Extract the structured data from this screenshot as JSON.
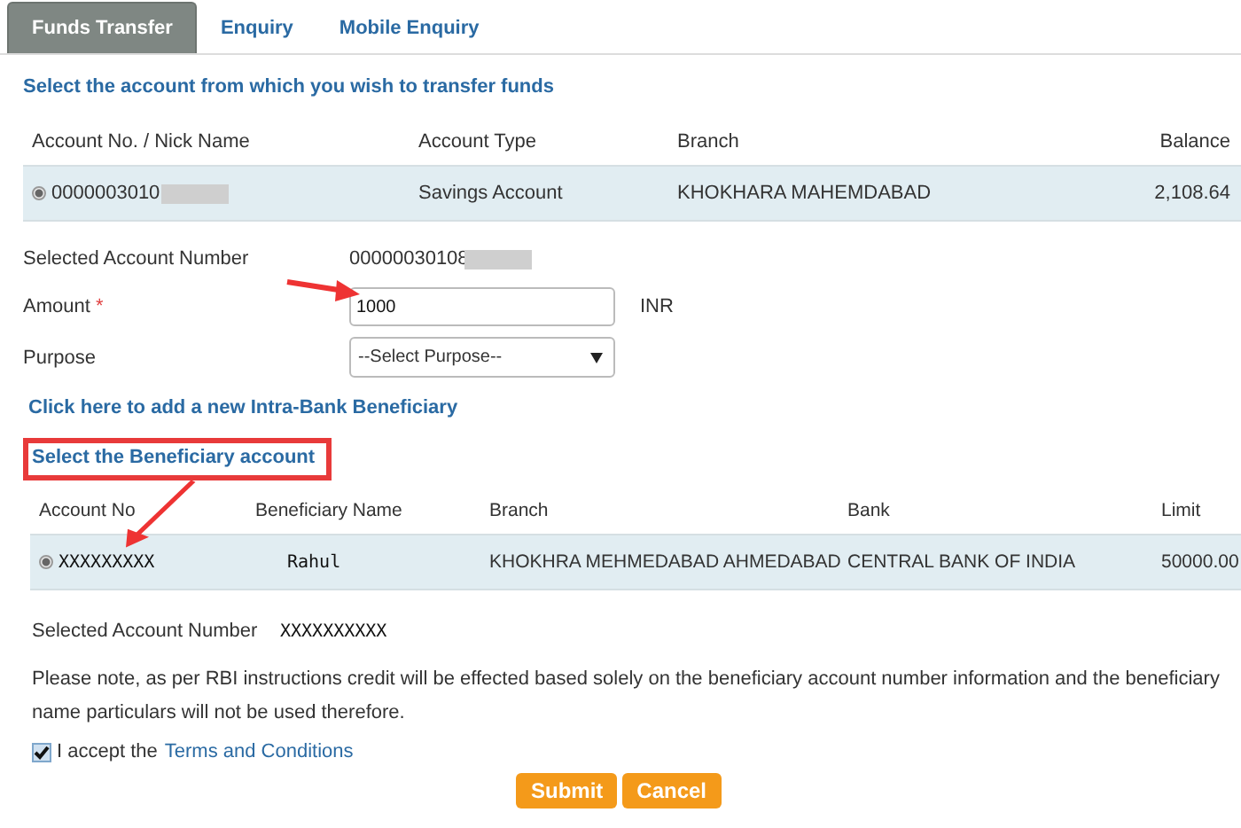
{
  "tabs": [
    {
      "label": "Funds Transfer",
      "selected": true
    },
    {
      "label": "Enquiry",
      "selected": false
    },
    {
      "label": "Mobile Enquiry",
      "selected": false
    }
  ],
  "source": {
    "heading": "Select the account from which you wish to transfer funds",
    "columns": [
      "Account No. / Nick Name",
      "Account Type",
      "Branch",
      "Balance"
    ],
    "rows": [
      {
        "account": "0000003010",
        "redacted": true,
        "type": "Savings Account",
        "branch": "KHOKHARA MAHEMDABAD",
        "balance": "2,108.64",
        "selected": true
      }
    ]
  },
  "selected_account": {
    "label": "Selected Account Number",
    "value": "00000030108",
    "redacted": true
  },
  "amount": {
    "label": "Amount",
    "required_mark": "*",
    "value": "1000",
    "currency": "INR"
  },
  "purpose": {
    "label": "Purpose",
    "value": "--Select Purpose--"
  },
  "add_link": "Click here to add a new Intra-Bank Beneficiary",
  "beneficiary": {
    "heading": "Select the Beneficiary account",
    "columns": [
      "Account No",
      "Beneficiary Name",
      "Branch",
      "Bank",
      "Limit"
    ],
    "rows": [
      {
        "account_no": "XXXXXXXXX",
        "name": "Rahul",
        "branch": "KHOKHRA MEHMEDABAD AHMEDABAD",
        "bank": "CENTRAL BANK OF INDIA",
        "limit": "50000.00",
        "selected": true
      }
    ]
  },
  "selected_beneficiary": {
    "label": "Selected Account Number",
    "value": "XXXXXXXXXX"
  },
  "note": "Please note, as per RBI instructions credit will be effected based solely on the beneficiary account number information and the beneficiary name particulars will not be used therefore.",
  "accept": {
    "checked": true,
    "text": "I accept the",
    "link": "Terms and Conditions"
  },
  "buttons": [
    {
      "label": "Submit"
    },
    {
      "label": "Cancel"
    }
  ]
}
